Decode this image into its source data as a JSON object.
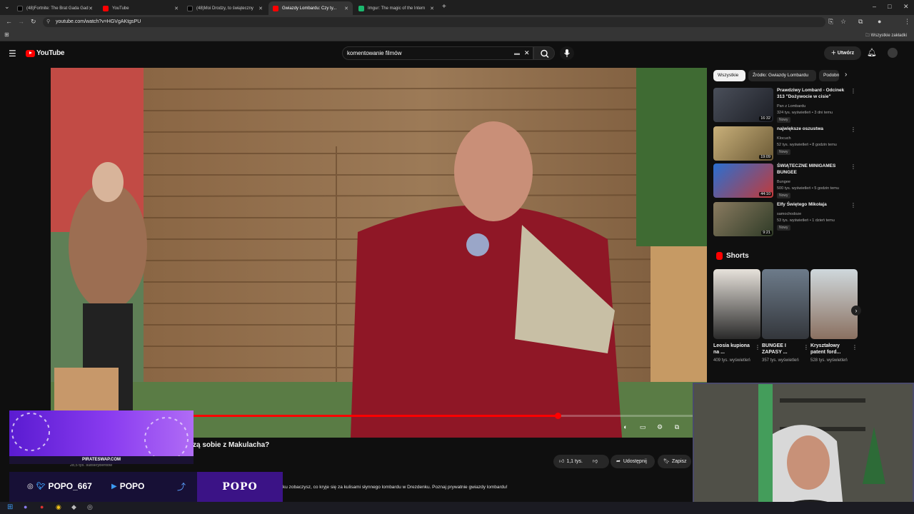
{
  "browser": {
    "tabs": [
      {
        "title": "(48)Fortnite: The Brat Gada Gad",
        "active": false
      },
      {
        "title": "YouTube",
        "active": false
      },
      {
        "title": "(48)Moi Drodzy, to świąteczny",
        "active": false
      },
      {
        "title": "Gwiazdy Lombardu: Czy ty...",
        "active": true
      },
      {
        "title": "Imgur: The magic of the Intern",
        "active": false
      }
    ],
    "url": "youtube.com/watch?v=HGVgAKtgsPU",
    "bookmarks_label": "Wszystkie zakładki"
  },
  "youtube": {
    "logo_text": "YouTube",
    "search_value": "komentowanie filmów",
    "create_label": "Utwórz"
  },
  "video": {
    "title_visible": "zą sobie z Makulacha?",
    "progress": 0.73,
    "subs_partial": "28,5 tys. subskrybentów",
    "like_label": "1,1 tys.",
    "share_label": "Udostępnij",
    "save_label": "Zapisz",
    "description": "ku zobaczysz, co kryje się za kulisami słynnego lombardu w Drezdenku. Poznaj prywatnie gwiazdy lombardu!"
  },
  "sidebar": {
    "chips": [
      "Wszystkie",
      "Źródło: Gwiazdy Lombardu",
      "Podobne"
    ],
    "recommendations": [
      {
        "title": "Prawdziwy Lombard - Odcinek 313 \"Dożywocie w cisie\"",
        "channel": "Pan z Lombardu",
        "meta": "324 tys. wyświetleń • 3 dni temu",
        "badge": "Nowy",
        "duration": "16:32"
      },
      {
        "title": "największe oszustwa",
        "channel": "Klocuch",
        "meta": "52 tys. wyświetleń • 8 godzin temu",
        "badge": "Nowy",
        "duration": "19:09"
      },
      {
        "title": "ŚWIĄTECZNE MINIGAMES BUNGEE",
        "channel": "Bungee",
        "meta": "500 tys. wyświetleń • 5 godzin temu",
        "badge": "Nowy",
        "duration": "44:10"
      },
      {
        "title": "Elfy Świętego Mikołaja",
        "channel": "samochodoze",
        "meta": "53 tys. wyświetleń • 1 dzień temu",
        "badge": "Nowy",
        "duration": "9:21"
      }
    ],
    "shorts_title": "Shorts",
    "shorts": [
      {
        "title": "Leosia kupiona na ...",
        "views": "409 tys. wyświetleń"
      },
      {
        "title": "BUNGEE I ZAPASY ...",
        "views": "357 tys. wyświetleń"
      },
      {
        "title": "Kryształowy patent ford...",
        "views": "528 tys. wyświetleń"
      }
    ]
  },
  "overlay": {
    "banner_text": "PIRATESWAP.COM",
    "social_handle_1": "POPO_667",
    "social_handle_2": "POPO",
    "logo_text": "POPO"
  },
  "colors": {
    "accent": "#ff0000",
    "background": "#0f0f0f",
    "overlay_purple": "#5a1bd1"
  }
}
